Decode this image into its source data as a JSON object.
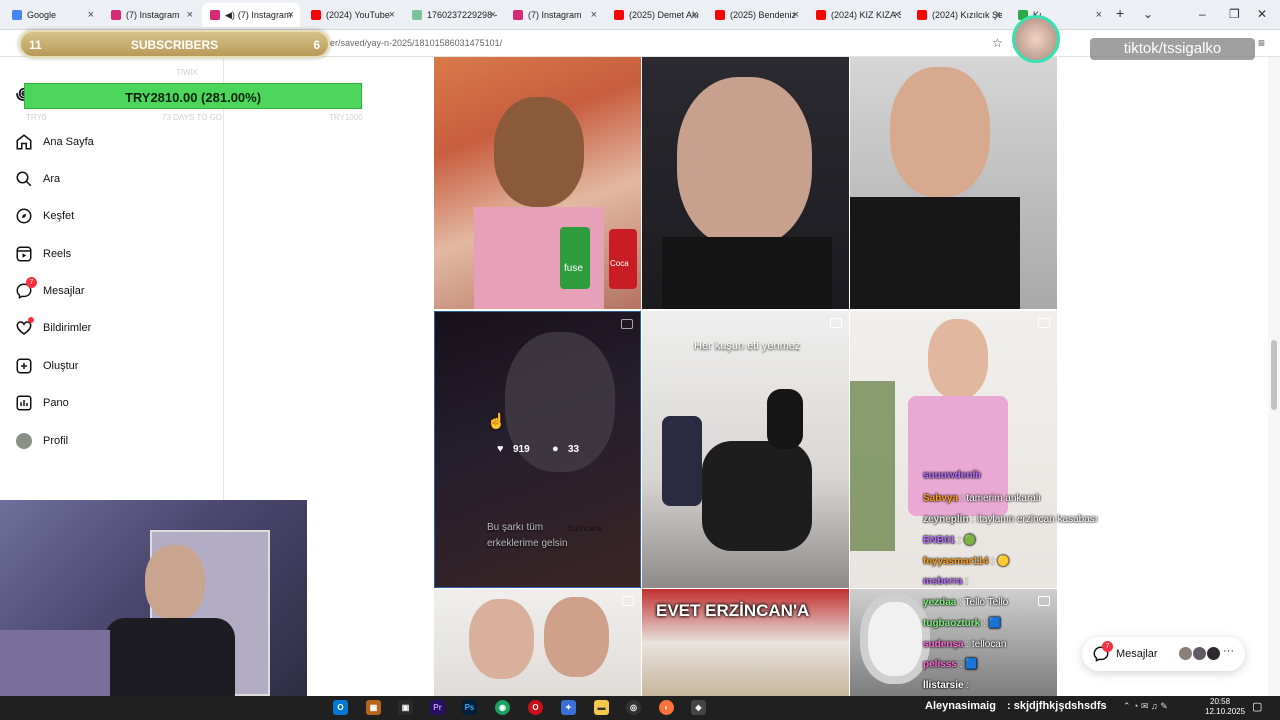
{
  "tabs": [
    {
      "label": "Google",
      "color": "#4285f4"
    },
    {
      "label": "(7) Instagram",
      "color": "#d62976"
    },
    {
      "label": "(7) Instagram",
      "color": "#d62976",
      "active": true
    },
    {
      "label": "(2024) YouTube",
      "color": "#ff0000"
    },
    {
      "label": "1760237229298 -",
      "color": "#7cc29a"
    },
    {
      "label": "(7) Instagram",
      "color": "#d62976"
    },
    {
      "label": "(2025) Demet Akı",
      "color": "#ff0000"
    },
    {
      "label": "(2025) Bendeniz",
      "color": "#ff0000"
    },
    {
      "label": "(2024) KIZ KIZA S",
      "color": "#ff0000"
    },
    {
      "label": "(2024) Kızılcık Şer",
      "color": "#ff0000"
    },
    {
      "label": "Kı",
      "color": "#2aa84a"
    }
  ],
  "address": {
    "url": "er/saved/yay-n-2025/18101586031475101/"
  },
  "subscribers": {
    "left": "11",
    "title": "SUBSCRIBERS",
    "right": "6"
  },
  "donation": {
    "text": "TRY2810.00 (281.00%)",
    "faint_top": "TİWİK",
    "faint_left": "TRY0",
    "faint_mid": "73 DAYS TO GO",
    "faint_right": "TRY1000"
  },
  "sidebar": {
    "items": [
      {
        "label": "Ana Sayfa",
        "icon": "home-icon"
      },
      {
        "label": "Ara",
        "icon": "search-icon"
      },
      {
        "label": "Keşfet",
        "icon": "compass-icon"
      },
      {
        "label": "Reels",
        "icon": "reels-icon"
      },
      {
        "label": "Mesajlar",
        "icon": "messenger-icon",
        "badge": "7"
      },
      {
        "label": "Bildirimler",
        "icon": "heart-icon",
        "dot": true
      },
      {
        "label": "Oluştur",
        "icon": "plus-square-icon"
      },
      {
        "label": "Pano",
        "icon": "chart-icon"
      },
      {
        "label": "Profil",
        "icon": "profile-avatar"
      }
    ]
  },
  "grid": {
    "hover_likes": "919",
    "hover_comments": "33",
    "text_kus": "Her kuşun eti yenmez",
    "text_erzincan": "EVET ERZİNCAN'A",
    "caption_1": "Bu şarkı tüm",
    "caption_2": "erkeklerime gelsin",
    "caption_3": "Erzincanlı",
    "can_label_1": "fuse",
    "can_label_2": "Coca"
  },
  "chat": [
    {
      "user": "suuuwdenliı",
      "msg": "",
      "color": "#b56cff"
    },
    {
      "user": "Sabvya",
      "msg": " : tamerim ankaralı",
      "color": "#ff9f1a"
    },
    {
      "user": "zeyneplin",
      "msg": " : itaylanın erzincan kasabası",
      "color": "#e6e6e6"
    },
    {
      "user": "ENB01",
      "msg": " : 🟢",
      "color": "#b56cff"
    },
    {
      "user": "feyyasmar114",
      "msg": " : 🟡",
      "color": "#ff9f1a"
    },
    {
      "user": "msberra",
      "msg": " : ",
      "color": "#b56cff"
    },
    {
      "user": "yezdaa",
      "msg": " : Tello Tello",
      "color": "#7cf07c"
    },
    {
      "user": "tugbaozturk",
      "msg": " : 🟦",
      "color": "#7cf07c"
    },
    {
      "user": "sudenşa",
      "msg": " : tellocan",
      "color": "#ff6ad5"
    },
    {
      "user": "pelisss",
      "msg": " : 🟦",
      "color": "#ff6ad5"
    },
    {
      "user": "llistarsie",
      "msg": " : ",
      "color": "#ffffff"
    }
  ],
  "chat_bottom": {
    "user": "Aleynasimaig",
    "msg": " : skjdjfhkjşdshsdfs"
  },
  "overlay": {
    "tiktok": "tiktok/tssigalko"
  },
  "messages_pill": {
    "label": "Mesajlar",
    "badge": "7"
  },
  "taskbar": {
    "time": "20:58",
    "date": "12.10.2025"
  },
  "colors": {
    "instagram_badge": "#ff3040",
    "donation_bar": "#4cd65c",
    "subs_gold": "#c9b070"
  }
}
